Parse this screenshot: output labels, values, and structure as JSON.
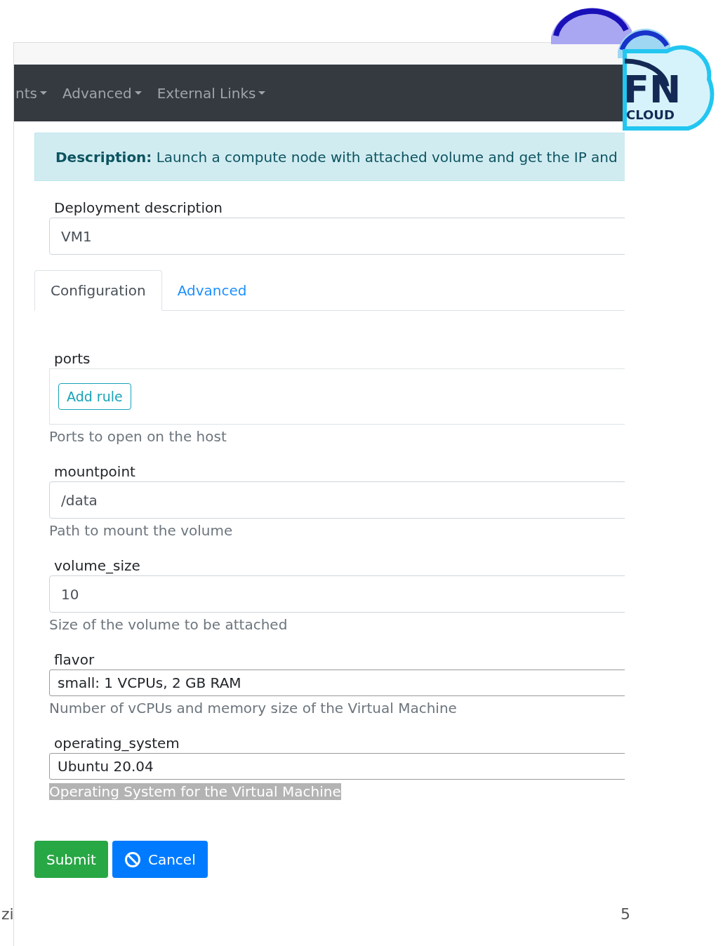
{
  "navbar": {
    "items": [
      {
        "label": "nts"
      },
      {
        "label": "Advanced"
      },
      {
        "label": "External Links"
      }
    ]
  },
  "logo": {
    "text": "FN",
    "subtext": "CLOUD"
  },
  "description": {
    "label": "Description:",
    "text": "Launch a compute node with attached volume and get the IP and"
  },
  "deployment": {
    "label": "Deployment description",
    "value": "VM1"
  },
  "tabs": [
    {
      "label": "Configuration",
      "selected": true
    },
    {
      "label": "Advanced",
      "selected": false
    }
  ],
  "fields": [
    {
      "kind": "rules",
      "label": "ports",
      "button": "Add rule",
      "help": "Ports to open on the host",
      "help_selected": false
    },
    {
      "kind": "text",
      "label": "mountpoint",
      "value": "/data",
      "help": "Path to mount the volume",
      "help_selected": false
    },
    {
      "kind": "text",
      "label": "volume_size",
      "value": "10",
      "help": "Size of the volume to be attached",
      "help_selected": false
    },
    {
      "kind": "select",
      "label": "flavor",
      "value": "small: 1 VCPUs, 2 GB RAM",
      "help": "Number of vCPUs and memory size of the Virtual Machine",
      "help_selected": false
    },
    {
      "kind": "select",
      "label": "operating_system",
      "value": "Ubuntu 20.04",
      "help": "Operating System for the Virtual Machine",
      "help_selected": true
    }
  ],
  "buttons": [
    {
      "kind": "submit",
      "label": "Submit"
    },
    {
      "kind": "cancel",
      "label": "Cancel"
    }
  ],
  "fragments": [
    "zi",
    "5"
  ]
}
